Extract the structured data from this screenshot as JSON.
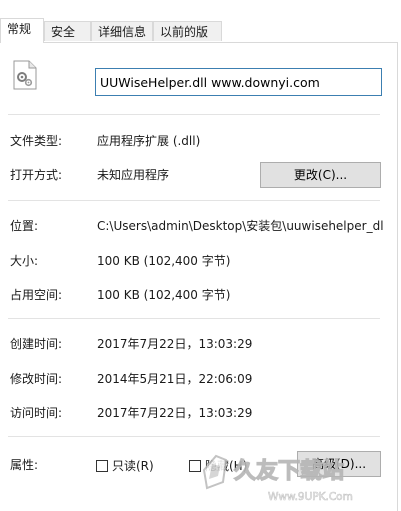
{
  "tabs": [
    {
      "label": "常规",
      "active": true
    },
    {
      "label": "安全",
      "active": false
    },
    {
      "label": "详细信息",
      "active": false
    },
    {
      "label": "以前的版本",
      "active": false
    }
  ],
  "file": {
    "name": "UUWiseHelper.dll www.downyi.com",
    "icon": "dll-file-icon"
  },
  "type_row": {
    "label": "文件类型:",
    "value": "应用程序扩展 (.dll)"
  },
  "open_row": {
    "label": "打开方式:",
    "value": "未知应用程序",
    "button": "更改(C)..."
  },
  "location_row": {
    "label": "位置:",
    "value": "C:\\Users\\admin\\Desktop\\安装包\\uuwisehelper_dll"
  },
  "size_row": {
    "label": "大小:",
    "value": "100 KB (102,400 字节)"
  },
  "disk_row": {
    "label": "占用空间:",
    "value": "100 KB (102,400 字节)"
  },
  "created_row": {
    "label": "创建时间:",
    "value": "2017年7月22日，13:03:29"
  },
  "modified_row": {
    "label": "修改时间:",
    "value": "2014年5月21日，22:06:09"
  },
  "accessed_row": {
    "label": "访问时间:",
    "value": "2017年7月22日，13:03:29"
  },
  "attributes": {
    "label": "属性:",
    "readonly": "只读(R)",
    "hidden": "隐藏(H)",
    "advanced_button": "高级(D)..."
  },
  "watermark": {
    "brand": "久友下载站",
    "url": "Www.9UPK.Com"
  },
  "colors": {
    "accent": "#3c7fb1",
    "tab_bg": "#f0f0f0",
    "button_bg": "#e1e1e1",
    "separator": "#e3e3e3"
  }
}
